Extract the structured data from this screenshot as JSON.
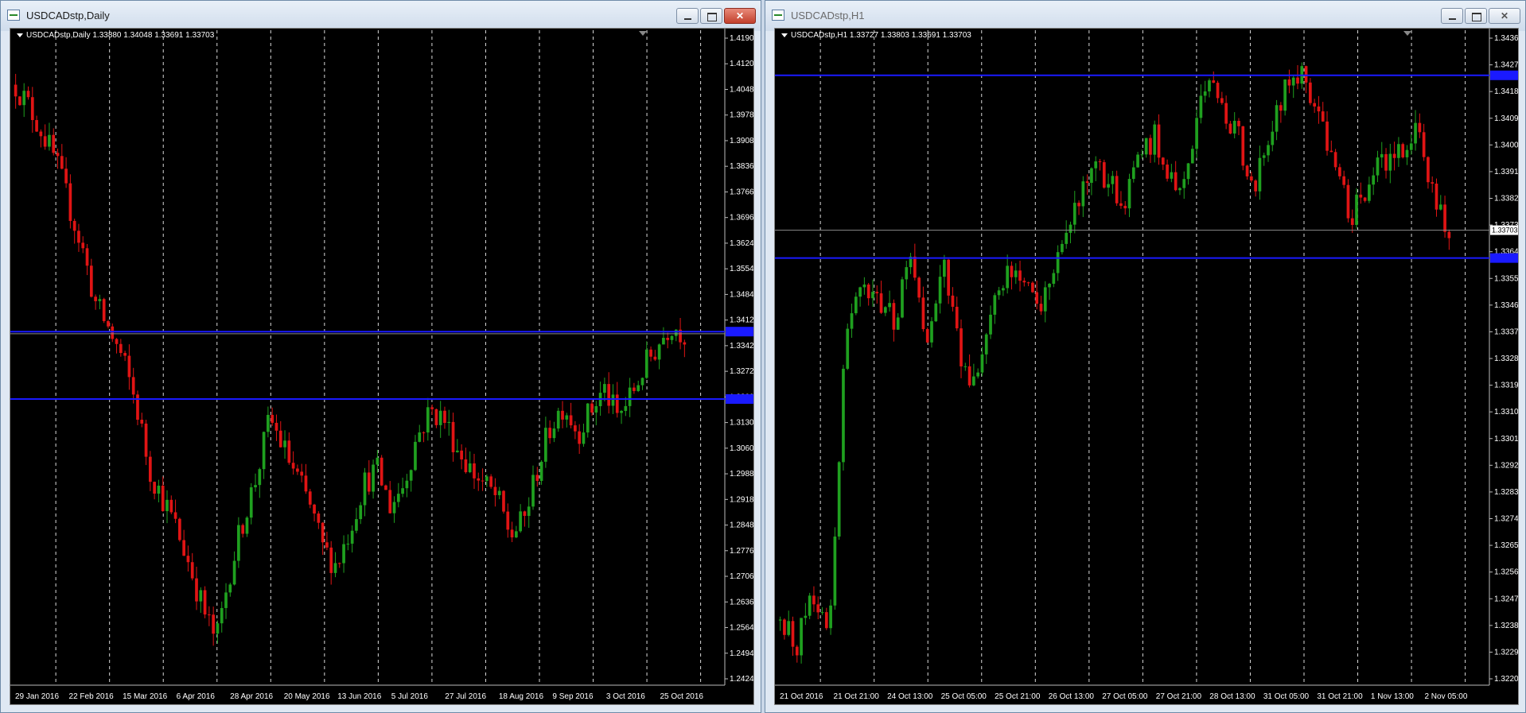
{
  "windows": [
    {
      "id": "daily",
      "title": "USDCADstp,Daily",
      "controls": {
        "minimize": "",
        "maximize": "",
        "close": "✕"
      },
      "ohlc_header": "USDCADstp,Daily  1.33880 1.34048 1.33691 1.33703",
      "price_labels": [
        "1.41900",
        "1.41200",
        "1.40480",
        "1.39780",
        "1.39080",
        "1.38360",
        "1.37660",
        "1.36960",
        "1.36240",
        "1.35540",
        "1.34840",
        "1.34120",
        "1.33420",
        "1.32720",
        "1.32000",
        "1.31300",
        "1.30600",
        "1.29880",
        "1.29180",
        "1.28480",
        "1.27760",
        "1.27060",
        "1.26360",
        "1.25640",
        "1.24940",
        "1.24240"
      ],
      "time_labels": [
        "29 Jan 2016",
        "22 Feb 2016",
        "15 Mar 2016",
        "6 Apr 2016",
        "28 Apr 2016",
        "20 May 2016",
        "13 Jun 2016",
        "5 Jul 2016",
        "27 Jul 2016",
        "18 Aug 2016",
        "9 Sep 2016",
        "3 Oct 2016",
        "25 Oct 2016"
      ],
      "levels": {
        "resistance": 1.3376,
        "support": 1.3192
      },
      "current_price": 1.33703
    },
    {
      "id": "h1",
      "title": "USDCADstp,H1",
      "controls": {
        "minimize": "",
        "maximize": "",
        "close": "✕"
      },
      "ohlc_header": "USDCADstp,H1  1.33727 1.33803 1.33691 1.33703",
      "price_labels": [
        "1.34360",
        "1.34270",
        "1.34180",
        "1.34090",
        "1.34000",
        "1.33910",
        "1.33820",
        "1.33730",
        "1.33640",
        "1.33550",
        "1.33460",
        "1.33370",
        "1.33280",
        "1.33190",
        "1.33100",
        "1.33010",
        "1.32920",
        "1.32830",
        "1.32740",
        "1.32650",
        "1.32560",
        "1.32470",
        "1.32380",
        "1.32290",
        "1.32200"
      ],
      "current_tag": "1.33703",
      "time_labels": [
        "21 Oct 2016",
        "21 Oct 21:00",
        "24 Oct 13:00",
        "25 Oct 05:00",
        "25 Oct 21:00",
        "26 Oct 13:00",
        "27 Oct 05:00",
        "27 Oct 21:00",
        "28 Oct 13:00",
        "31 Oct 05:00",
        "31 Oct 21:00",
        "1 Nov 13:00",
        "2 Nov 05:00"
      ],
      "levels": {
        "resistance": 1.3422,
        "support": 1.3361
      },
      "current_price": 1.33703
    }
  ],
  "colors": {
    "bull": "#1fa01f",
    "bear": "#e01414",
    "level": "#1a1aff",
    "grid": "#ffffff",
    "current": "#8a8a8a"
  },
  "chart_data": [
    {
      "type": "candlestick",
      "title": "USDCADstp,Daily",
      "ylim": [
        1.2424,
        1.419
      ],
      "x": [
        "29 Jan 2016",
        "22 Feb 2016",
        "15 Mar 2016",
        "6 Apr 2016",
        "28 Apr 2016",
        "20 May 2016",
        "13 Jun 2016",
        "5 Jul 2016",
        "27 Jul 2016",
        "18 Aug 2016",
        "9 Sep 2016",
        "3 Oct 2016",
        "25 Oct 2016"
      ],
      "close_path": [
        1.405,
        1.399,
        1.392,
        1.384,
        1.372,
        1.36,
        1.345,
        1.338,
        1.33,
        1.318,
        1.3,
        1.292,
        1.284,
        1.274,
        1.262,
        1.253,
        1.272,
        1.286,
        1.298,
        1.314,
        1.306,
        1.298,
        1.29,
        1.278,
        1.274,
        1.284,
        1.296,
        1.3,
        1.29,
        1.296,
        1.309,
        1.316,
        1.314,
        1.306,
        1.3,
        1.296,
        1.292,
        1.282,
        1.286,
        1.3,
        1.312,
        1.318,
        1.31,
        1.316,
        1.322,
        1.314,
        1.32,
        1.328,
        1.334,
        1.34,
        1.337
      ],
      "levels": [
        1.3376,
        1.3192
      ],
      "grid": true
    },
    {
      "type": "candlestick",
      "title": "USDCADstp,H1",
      "ylim": [
        1.322,
        1.3436
      ],
      "x": [
        "21 Oct 2016",
        "21 Oct 21:00",
        "24 Oct 13:00",
        "25 Oct 05:00",
        "25 Oct 21:00",
        "26 Oct 13:00",
        "27 Oct 05:00",
        "27 Oct 21:00",
        "28 Oct 13:00",
        "31 Oct 05:00",
        "31 Oct 21:00",
        "1 Nov 13:00",
        "2 Nov 05:00"
      ],
      "close_path": [
        1.324,
        1.3232,
        1.325,
        1.3236,
        1.3335,
        1.335,
        1.3345,
        1.334,
        1.336,
        1.3335,
        1.3358,
        1.333,
        1.3318,
        1.3345,
        1.3355,
        1.3352,
        1.3346,
        1.3362,
        1.3375,
        1.3392,
        1.3386,
        1.338,
        1.3395,
        1.3402,
        1.3386,
        1.3392,
        1.342,
        1.3412,
        1.3402,
        1.3385,
        1.3405,
        1.3418,
        1.3422,
        1.341,
        1.3392,
        1.3375,
        1.3385,
        1.3394,
        1.3398,
        1.3402,
        1.3384,
        1.337
      ],
      "levels": [
        1.3422,
        1.3361
      ],
      "grid": true
    }
  ]
}
